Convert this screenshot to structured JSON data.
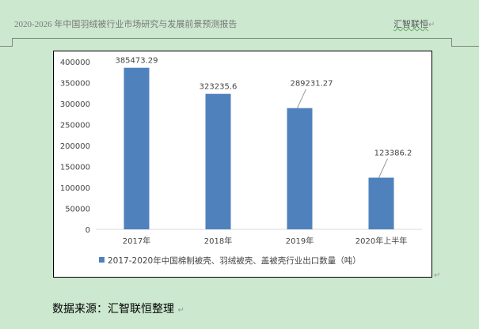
{
  "header": {
    "title": "2020-2026 年中国羽绒被行业市场研究与发展前景预测报告",
    "brand": "汇智联恒"
  },
  "chart_data": {
    "type": "bar",
    "categories": [
      "2017年",
      "2018年",
      "2019年",
      "2020年上半年"
    ],
    "series": [
      {
        "name": "2017-2020年中国棉制被壳、羽绒被壳、盖被壳行业出口数量（吨）",
        "values": [
          385473.29,
          323235.6,
          289231.27,
          123386.2
        ],
        "labels": [
          "385473.29",
          "323235.6",
          "289231.27",
          "123386.2"
        ],
        "color": "#4f81bd"
      }
    ],
    "ylim": [
      0,
      400000
    ],
    "yticks": [
      "0",
      "50000",
      "100000",
      "150000",
      "200000",
      "250000",
      "300000",
      "350000",
      "400000"
    ],
    "legend": "bottom",
    "grid": false
  },
  "footer": {
    "source": "数据来源：汇智联恒整理"
  }
}
